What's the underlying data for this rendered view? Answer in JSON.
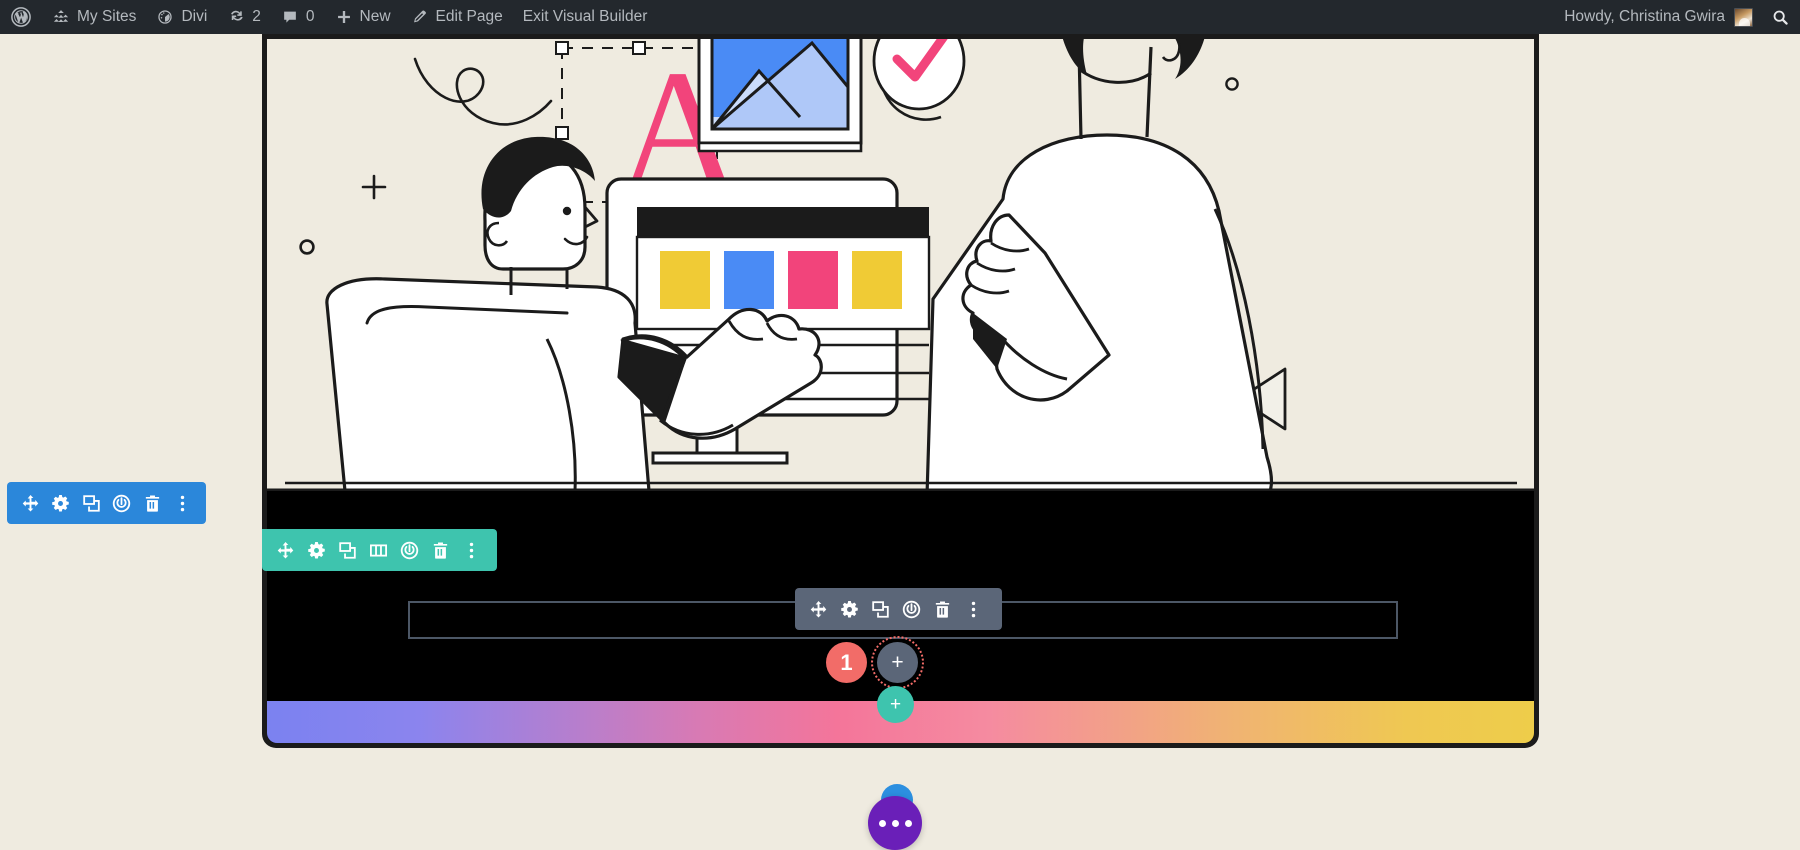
{
  "adminbar": {
    "wp_logo": "wordpress-logo-icon",
    "items": [
      {
        "icon": "sites-icon",
        "label": "My Sites"
      },
      {
        "icon": "dashboard-icon",
        "label": "Divi"
      },
      {
        "icon": "updates-icon",
        "label": "2"
      },
      {
        "icon": "comment-icon",
        "label": "0"
      },
      {
        "icon": "plus-icon",
        "label": "New"
      },
      {
        "icon": "pencil-icon",
        "label": "Edit Page"
      },
      {
        "icon": "",
        "label": "Exit Visual Builder"
      }
    ],
    "howdy": "Howdy, Christina Gwira",
    "avatar": "avatar",
    "search": "search-icon"
  },
  "builder": {
    "section_toolbar": {
      "name": "section-settings-toolbar",
      "color": "#2b87da",
      "icons": [
        "move-icon",
        "gear-icon",
        "duplicate-icon",
        "power-icon",
        "trash-icon",
        "more-options-icon"
      ]
    },
    "row_toolbar": {
      "name": "row-settings-toolbar",
      "color": "#3ec4ae",
      "icons": [
        "move-icon",
        "gear-icon",
        "duplicate-icon",
        "columns-icon",
        "power-icon",
        "trash-icon",
        "more-options-icon"
      ]
    },
    "module_toolbar": {
      "name": "module-settings-toolbar",
      "color": "#5b6678",
      "icons": [
        "move-icon",
        "gear-icon",
        "duplicate-icon",
        "power-icon",
        "trash-icon",
        "more-options-icon"
      ]
    },
    "module_count_badge": "1",
    "add_module_button": "+",
    "add_row_button": "+",
    "fab": {
      "label": "divi-menu-button",
      "dots": [
        "dot",
        "dot",
        "dot"
      ],
      "color": "#6a1fb8",
      "secondary_color": "#2c8fe0"
    }
  },
  "section_hero": {
    "name": "hero-section",
    "background": "#EFEBE0",
    "border_color": "#1b1b1b",
    "illustration": {
      "name": "designers-collaboration-illustration",
      "accent_pink": "#F2447B",
      "accent_blue": "#4A8BF5",
      "accent_yellow": "#F0CB35",
      "letter_glyph": "A",
      "swatches": [
        "#F0CB35",
        "#4A8BF5",
        "#F2447B",
        "#F0CB35"
      ],
      "decorations": [
        "plus-mark",
        "small-circle",
        "small-circle",
        "triangle",
        "squiggle",
        "checkmark-circle",
        "image-placeholder",
        "selection-handles"
      ]
    }
  },
  "section_black": {
    "name": "black-section",
    "background": "#000000",
    "gradient_bar": {
      "name": "gradient-divider",
      "stops": [
        "#7b82f0",
        "#f4759a",
        "#eecd4a"
      ]
    }
  },
  "colors": {
    "adminbar_bg": "#23282d",
    "canvas_bg": "#EFEBE0",
    "blue": "#2b87da",
    "teal": "#3ec4ae",
    "slate": "#5b6678",
    "coral": "#f26c68"
  }
}
